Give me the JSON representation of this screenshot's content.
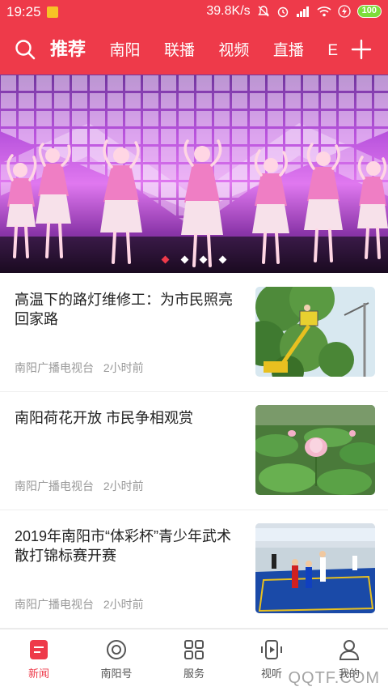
{
  "status_bar": {
    "time": "19:25",
    "network_speed": "39.8K/s",
    "battery": "100"
  },
  "header": {
    "tabs": [
      "推荐",
      "南阳",
      "联播",
      "视频",
      "直播",
      "E"
    ],
    "active_tab": 0,
    "accent_color": "#ee3a4a"
  },
  "banner": {
    "slide_count": 4,
    "active_slide": 0
  },
  "news": [
    {
      "title": "高温下的路灯维修工：为市民照亮回家路",
      "source": "南阳广播电视台",
      "time": "2小时前",
      "thumb": "street-light-repair"
    },
    {
      "title": "南阳荷花开放  市民争相观赏",
      "source": "南阳广播电视台",
      "time": "2小时前",
      "thumb": "lotus-flowers"
    },
    {
      "title": "2019年南阳市“体彩杯”青少年武术散打锦标赛开赛",
      "source": "南阳广播电视台",
      "time": "2小时前",
      "thumb": "martial-arts-match"
    }
  ],
  "bottom_nav": [
    {
      "label": "新闻",
      "icon": "news-icon"
    },
    {
      "label": "南阳号",
      "icon": "target-icon"
    },
    {
      "label": "服务",
      "icon": "grid-icon"
    },
    {
      "label": "视听",
      "icon": "media-icon"
    },
    {
      "label": "我的",
      "icon": "user-icon"
    }
  ],
  "watermark": "QQTF.COM"
}
